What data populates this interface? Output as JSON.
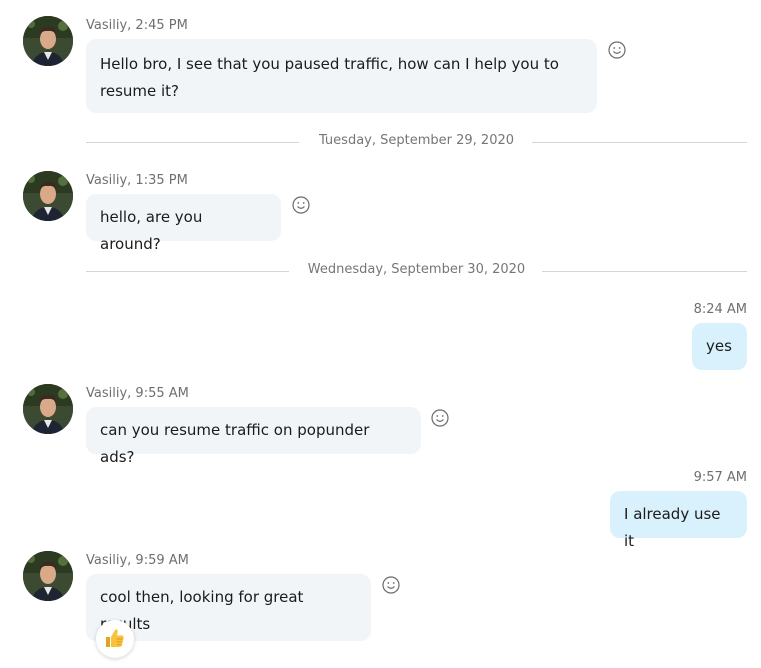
{
  "messages": [
    {
      "sender": "Vasiliy",
      "meta": "Vasiliy, 2:45 PM",
      "text": "Hello bro, I see that you paused traffic, how can I help you to resume it?"
    },
    {
      "sender": "Vasiliy",
      "meta": "Vasiliy, 1:35 PM",
      "text": "hello, are you around?"
    },
    {
      "sender": "me",
      "meta": "8:24 AM",
      "text": "yes"
    },
    {
      "sender": "Vasiliy",
      "meta": "Vasiliy, 9:55 AM",
      "text": "can you resume traffic on popunder ads?"
    },
    {
      "sender": "me",
      "meta": "9:57 AM",
      "text": "I already use it"
    },
    {
      "sender": "Vasiliy",
      "meta": "Vasiliy, 9:59 AM",
      "text": "cool then, looking for great results"
    }
  ],
  "dividers": [
    "Tuesday, September 29, 2020",
    "Wednesday, September 30, 2020"
  ],
  "icons": {
    "emoji": "smiley-icon",
    "reaction": "thumbs-up-icon",
    "avatar": "avatar"
  },
  "colors": {
    "incoming": "#f2f5f8",
    "outgoing": "#d8f1fc",
    "meta": "#6f6f6f"
  }
}
